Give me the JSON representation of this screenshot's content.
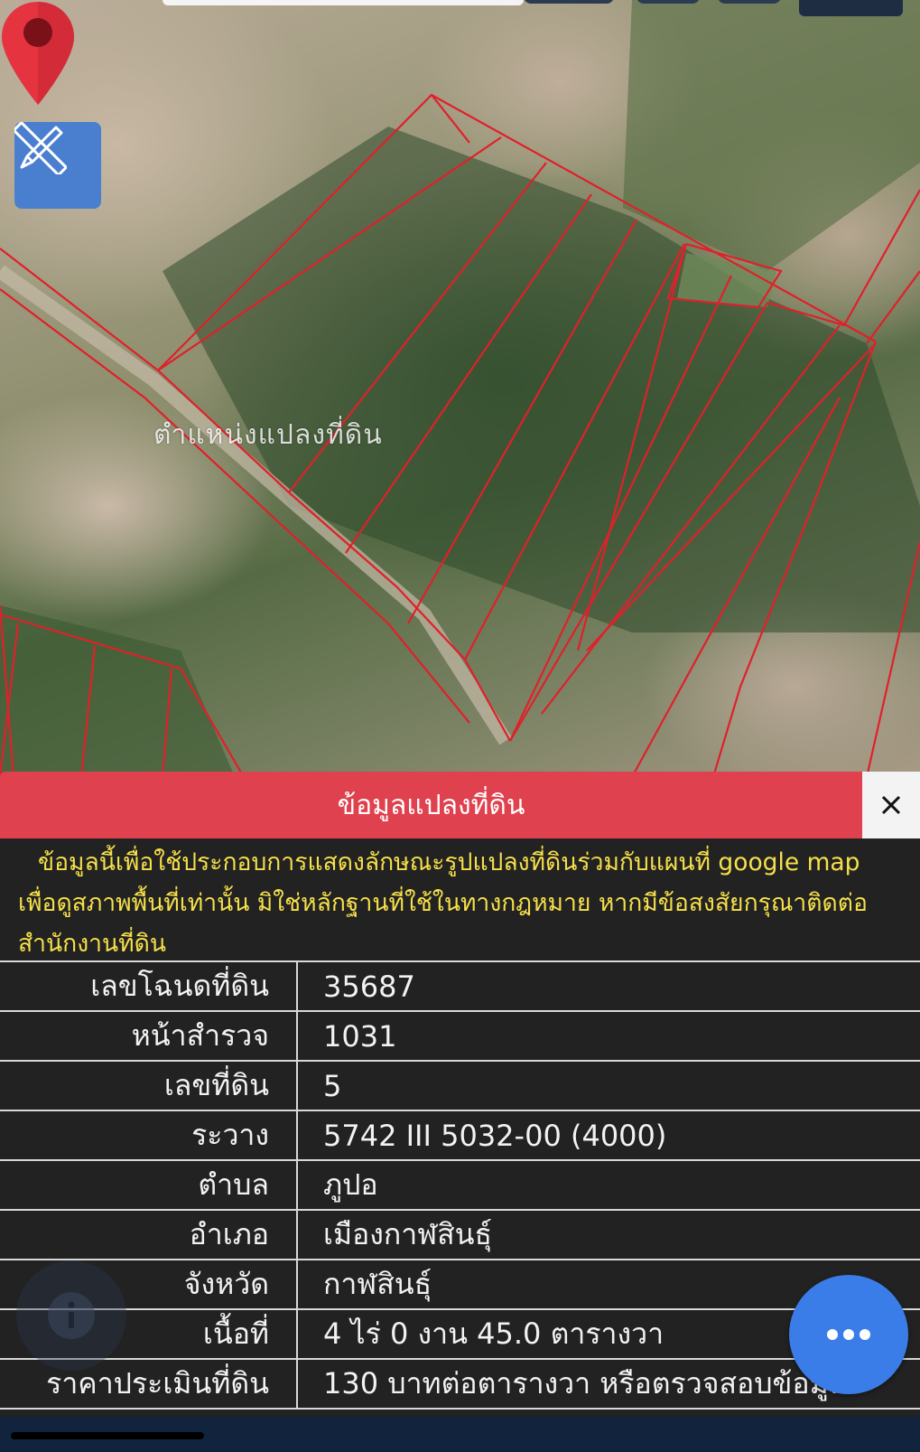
{
  "map": {
    "parcel_label": "ตำแหน่งแปลงที่ดิน",
    "tool_icon": "pencil-ruler-icon",
    "pin_icon": "location-pin-icon",
    "pin_color": "#e53340",
    "boundary_color": "#e0202a"
  },
  "panel": {
    "title": "ข้อมูลแปลงที่ดิน",
    "close_icon": "close-icon",
    "header_color": "#e0414e",
    "disclaimer": "ข้อมูลนี้เพื่อใช้ประกอบการแสดงลักษณะรูปแปลงที่ดินร่วมกับแผนที่ google map เพื่อดูสภาพพื้นที่เท่านั้น มิใช่หลักฐานที่ใช้ในทางกฎหมาย หากมีข้อสงสัยกรุณาติดต่อสำนักงานที่ดิน",
    "disclaimer_color": "#f6e04a",
    "rows": [
      {
        "label": "เลขโฉนดที่ดิน",
        "value": "35687"
      },
      {
        "label": "หน้าสำรวจ",
        "value": "1031"
      },
      {
        "label": "เลขที่ดิน",
        "value": "5"
      },
      {
        "label": "ระวาง",
        "value": "5742 III 5032-00 (4000)"
      },
      {
        "label": "ตำบล",
        "value": "ภูปอ"
      },
      {
        "label": "อำเภอ",
        "value": "เมืองกาฬสินธุ์"
      },
      {
        "label": "จังหวัด",
        "value": "กาฬสินธุ์"
      },
      {
        "label": "เนื้อที่",
        "value": "4 ไร่ 0 งาน 45.0 ตารางวา"
      },
      {
        "label": "ราคาประเมินที่ดิน",
        "value": "130 บาทต่อตารางวา หรือตรวจสอบข้อมูล"
      }
    ]
  },
  "fab": {
    "more_icon": "more-horizontal-icon",
    "info_icon": "info-icon",
    "more_color": "#3a7de8"
  }
}
